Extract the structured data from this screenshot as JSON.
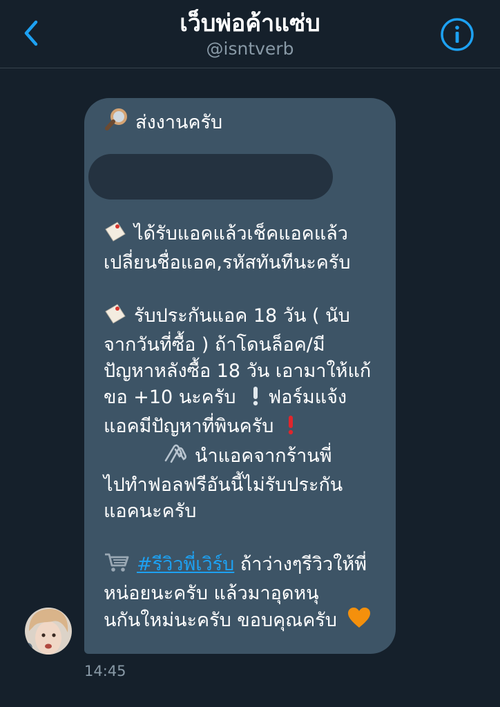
{
  "header": {
    "title": "เว็บพ่อค้าแซ่บ",
    "handle": "@isntverb"
  },
  "message": {
    "line_1": "ส่งงานครับ",
    "para_1": [
      "ได้รับแอคแล้วเช็คแอคแล้ว",
      "เปลี่ยนชื่อแอค,รหัสทันทีนะครับ"
    ],
    "para_2": [
      "รับประกันแอค 18 วัน ( นับ",
      "จากวันที่ซื้อ ) ถ้าโดนล็อค/มี",
      "ปัญหาหลังซื้อ 18 วัน เอามาให้แก้",
      "ขอ +10 นะครับ",
      "ฟอร์มแจ้ง",
      "แอคมีปัญหาที่พินครับ",
      "นำแอคจากร้านพี่",
      "ไปทำฟอลฟรีอันนี้ไม่รับประกัน",
      "แอคนะครับ"
    ],
    "hashtag": "#รีวิวพี่เวิร์บ",
    "para_3": [
      "ถ้าว่างๆรีวิวให้พี่",
      "หน่อยนะครับ แล้วมาอุดหนุ",
      "นกันใหม่นะครับ ขอบคุณครับ"
    ],
    "timestamp": "14:45"
  },
  "colors": {
    "background": "#15202b",
    "bubble": "#3d5466",
    "accent": "#1da1f2",
    "secondary_text": "#8899a6"
  },
  "icons": [
    "back-chevron-icon",
    "info-icon",
    "magnifier-icon",
    "tag-icon",
    "exclamation-icon",
    "paperclip-icon",
    "cart-icon",
    "orange-heart-icon"
  ]
}
